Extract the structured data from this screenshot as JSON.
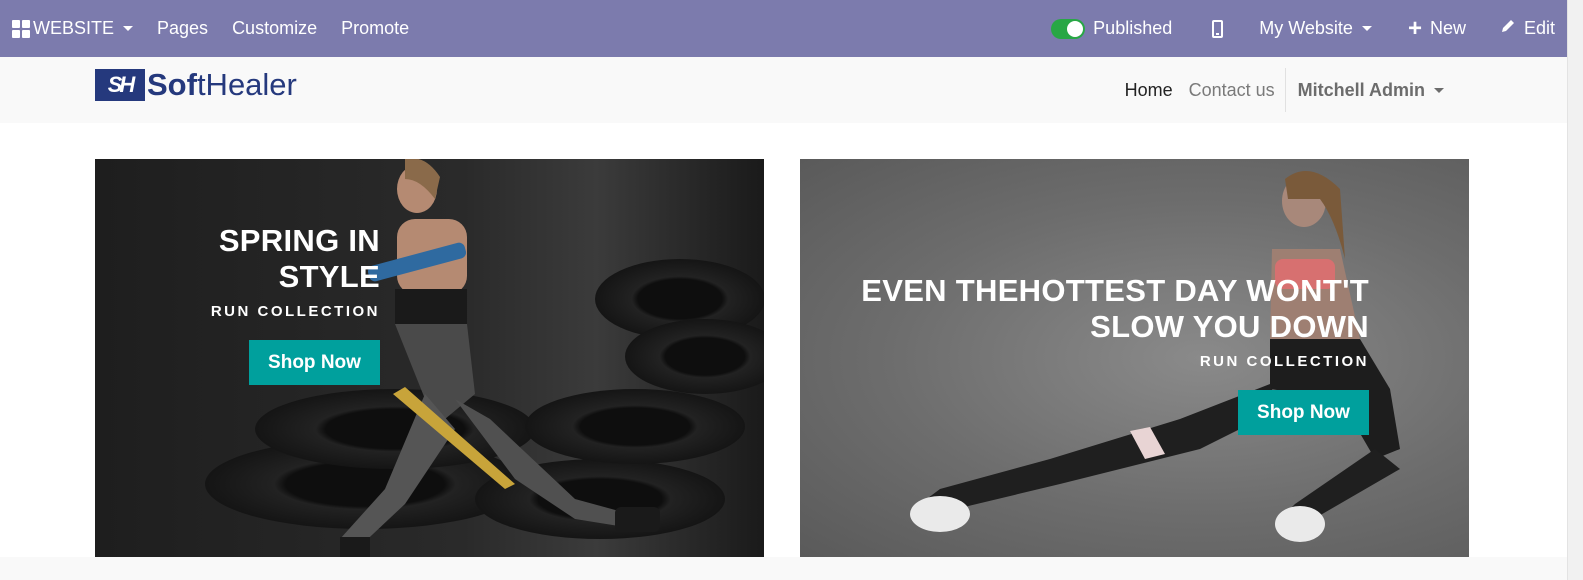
{
  "topbar": {
    "website_label": "WEBSITE",
    "pages_label": "Pages",
    "customize_label": "Customize",
    "promote_label": "Promote",
    "published_label": "Published",
    "my_website_label": "My Website",
    "new_label": "New",
    "edit_label": "Edit",
    "bg_color": "#7c7bad",
    "toggle_color": "#28a745"
  },
  "header": {
    "logo_mark": "SH",
    "logo_text_1": "Sof",
    "logo_text_2": "tH",
    "logo_text_3": "ealer",
    "nav": [
      {
        "label": "Home",
        "active": true
      },
      {
        "label": "Contact us",
        "active": false
      }
    ],
    "user_label": "Mitchell Admin",
    "logo_color": "#25397d"
  },
  "banners": [
    {
      "title": "SPRING IN STYLE",
      "subtitle": "RUN COLLECTION",
      "button_label": "Shop Now"
    },
    {
      "title_line1": "EVEN THEHOTTEST DAY WONT'T",
      "title_line2": "SLOW YOU DOWN",
      "subtitle": "RUN COLLECTION",
      "button_label": "Shop Now"
    }
  ],
  "accent_color": "#00a09d"
}
